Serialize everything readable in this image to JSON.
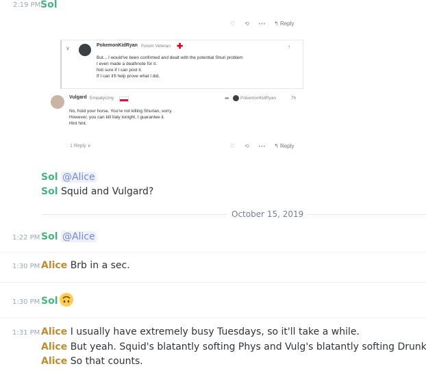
{
  "header": {
    "time": "2:19 PM",
    "author": "Sol"
  },
  "embed": {
    "actions": {
      "reply": "Reply",
      "more": "•••",
      "like": "♡",
      "share": "⟲"
    },
    "quote": {
      "author": "PokemonKidRyan",
      "rank": "Forum Veteran",
      "flag_color": "#d90012",
      "lines": [
        "But... I would've been confirmed and dealt with the potential Shuri problem",
        "I even made a deathnote for it.",
        "Not sure if I can post it.",
        "If I can it'll help prove what I did."
      ]
    },
    "reply_post": {
      "author": "Vulgard",
      "rank": "Empatyczny",
      "reply_to": "PokemonKidRyan",
      "age": "7h",
      "lines": [
        "No, hold your horse. You're not killing Shurian, sorry.",
        "However, you can kill Italy tonight, I guarantee it.",
        "Hint hint."
      ],
      "replies_label": "1 Reply ∨",
      "reply_label": "Reply"
    }
  },
  "messages": [
    {
      "time": "",
      "author": "Sol",
      "mention": "@Alice",
      "text": ""
    },
    {
      "time": "",
      "author": "Sol",
      "mention": "",
      "text": "Squid and Vulgard?"
    },
    {
      "date": "October 15, 2019"
    },
    {
      "time": "1:22 PM",
      "author": "Sol",
      "mention": "@Alice",
      "text": ""
    },
    {
      "time": "1:30 PM",
      "author": "Alice",
      "mention": "",
      "text": "Brb in a sec."
    },
    {
      "time": "1:30 PM",
      "author": "Sol",
      "mention": "",
      "text": ""
    },
    {
      "time": "1:31 PM",
      "author": "Alice",
      "mention": "",
      "text": "I usually have extremely busy Tuesdays, so it'll take a while."
    },
    {
      "time": "",
      "author": "Alice",
      "mention": "",
      "text": "But yeah. Squid's blatantly softing Phys and Vulg's blatantly softing Drunk."
    },
    {
      "time": "",
      "author": "Alice",
      "mention": "",
      "text": "So that counts."
    }
  ],
  "colors": {
    "sol": "#43b581",
    "alice": "#c18b2e",
    "mention": "#7289da"
  },
  "icons": {
    "emoji": "upside-down-face-icon"
  }
}
